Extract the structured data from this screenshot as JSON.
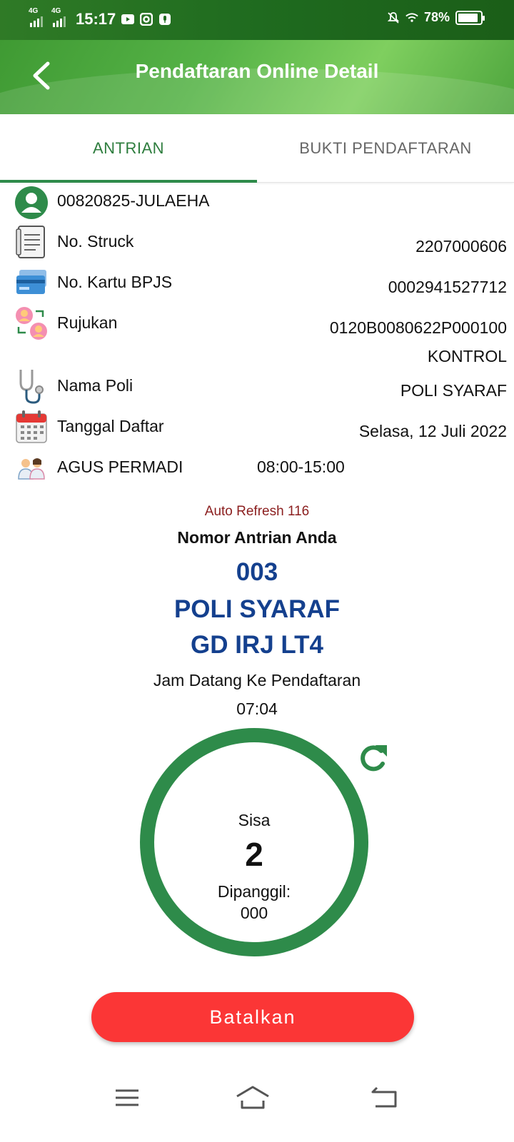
{
  "status_bar": {
    "network1": "4G",
    "network2": "4G",
    "time": "15:17",
    "battery": "78%",
    "battery_level": 0.78
  },
  "app_bar": {
    "title": "Pendaftaran Online Detail"
  },
  "tabs": [
    {
      "label": "ANTRIAN",
      "active": true
    },
    {
      "label": "BUKTI PENDAFTARAN",
      "active": false
    }
  ],
  "patient": {
    "id_name": "00820825-JULAEHA"
  },
  "details": {
    "struck_label": "No. Struck",
    "struck_value": "2207000606",
    "bpjs_label": "No. Kartu BPJS",
    "bpjs_value": "0002941527712",
    "rujukan_label": "Rujukan",
    "rujukan_value": "0120B0080622P000100",
    "rujukan_value2": "KONTROL",
    "poli_label": "Nama Poli",
    "poli_value": "POLI SYARAF",
    "tanggal_label": "Tanggal Daftar",
    "tanggal_value": "Selasa, 12 Juli 2022",
    "doctor_name": "AGUS PERMADI",
    "doctor_hours": "08:00-15:00"
  },
  "queue": {
    "auto_refresh": "Auto Refresh 116",
    "heading": "Nomor Antrian Anda",
    "number": "003",
    "poli": "POLI SYARAF",
    "location": "GD IRJ LT4",
    "arrival_label": "Jam Datang Ke Pendaftaran",
    "arrival_time": "07:04",
    "remaining_label": "Sisa",
    "remaining_value": "2",
    "called_label": "Dipanggil:",
    "called_value": "000"
  },
  "actions": {
    "cancel_label": "Batalkan"
  },
  "colors": {
    "primary_green": "#2e8b4a",
    "queue_blue": "#14408e",
    "cancel_red": "#fb3636",
    "auto_refresh_red": "#8b1e1e"
  }
}
